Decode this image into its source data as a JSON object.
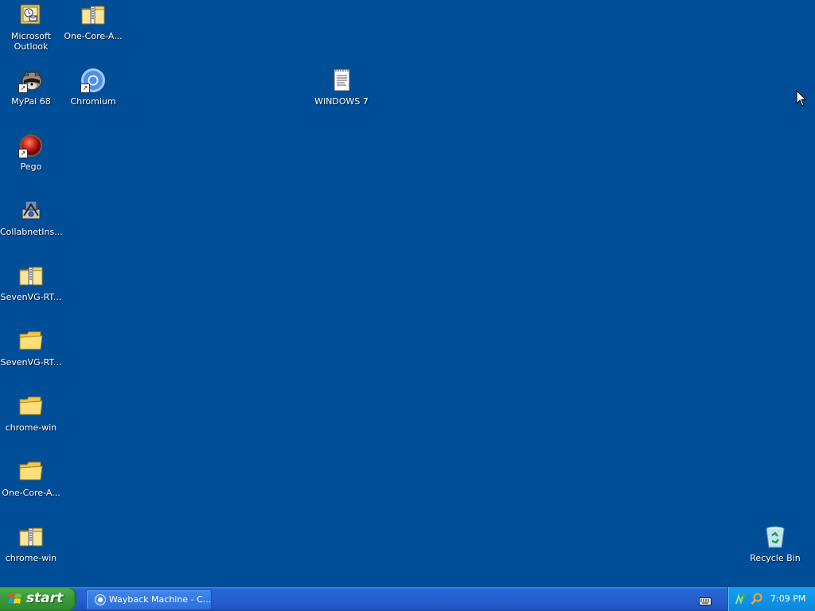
{
  "desktop": {
    "background_color": "#004e98",
    "icons": {
      "outlook": {
        "label": "Microsoft\nOutlook",
        "icon": "outlook-icon"
      },
      "onecore_zip": {
        "label": "One-Core-A...",
        "icon": "zip-folder-icon"
      },
      "mypal": {
        "label": "MyPal 68",
        "icon": "raccoon-icon"
      },
      "chromium": {
        "label": "Chromium",
        "icon": "chromium-icon"
      },
      "windows7": {
        "label": "WINDOWS 7",
        "icon": "text-document-icon"
      },
      "pego": {
        "label": "Pego",
        "icon": "red-ball-icon"
      },
      "collabnet": {
        "label": "CollabnetIns...",
        "icon": "installer-icon"
      },
      "sevenvg_zip": {
        "label": "SevenVG-RT...",
        "icon": "zip-folder-icon"
      },
      "sevenvg_folder": {
        "label": "SevenVG-RT...",
        "icon": "folder-icon"
      },
      "chrome_win_folder": {
        "label": "chrome-win",
        "icon": "folder-icon"
      },
      "onecore_folder": {
        "label": "One-Core-A...",
        "icon": "folder-icon"
      },
      "chrome_win_zip": {
        "label": "chrome-win",
        "icon": "zip-folder-icon"
      },
      "recycle_bin": {
        "label": "Recycle Bin",
        "icon": "recycle-bin-icon"
      }
    }
  },
  "taskbar": {
    "start_label": "start",
    "task_buttons": [
      {
        "label": "Wayback Machine - C...",
        "icon": "chromium-icon"
      }
    ],
    "tray": {
      "clock": "7:09 PM",
      "icons": [
        "network-icon",
        "search-icon"
      ]
    },
    "language_icon": "keyboard-icon",
    "start_color": "#3c9c3c",
    "taskbar_color": "#245edb",
    "tray_color": "#0f93e6"
  }
}
